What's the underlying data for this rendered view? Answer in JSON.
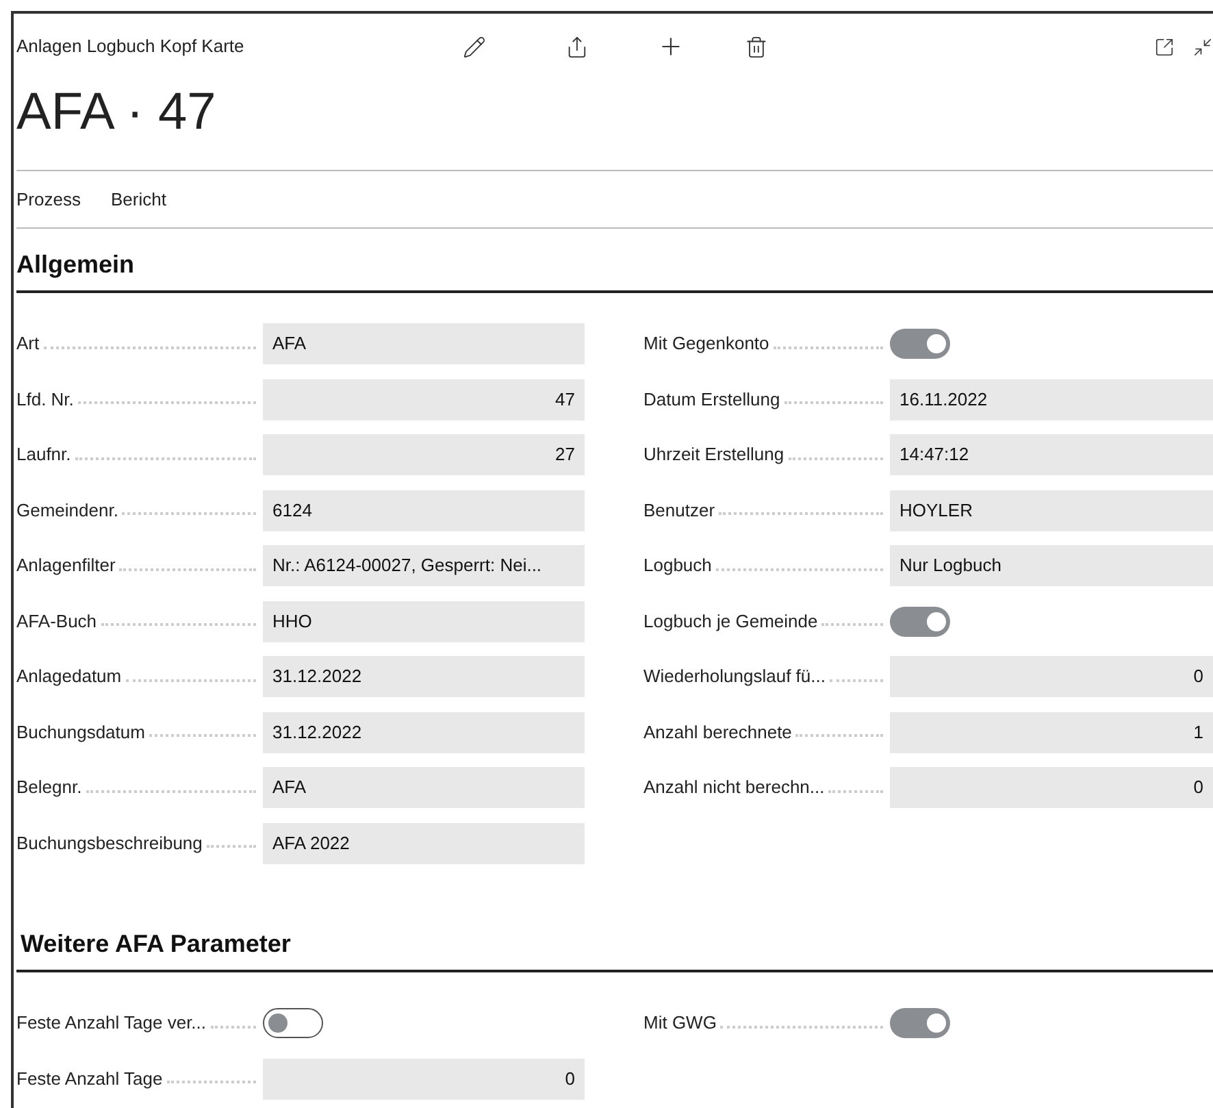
{
  "page": {
    "caption": "Anlagen Logbuch Kopf Karte",
    "title": "AFA · 47"
  },
  "actions": [
    "Prozess",
    "Bericht"
  ],
  "sections": [
    {
      "title": "Allgemein",
      "left": [
        {
          "kind": "text",
          "label": "Art",
          "value": "AFA",
          "numeric": false
        },
        {
          "kind": "text",
          "label": "Lfd. Nr.",
          "value": "47",
          "numeric": true
        },
        {
          "kind": "text",
          "label": "Laufnr.",
          "value": "27",
          "numeric": true
        },
        {
          "kind": "text",
          "label": "Gemeindenr.",
          "value": "6124",
          "numeric": false
        },
        {
          "kind": "text",
          "label": "Anlagenfilter",
          "value": "Nr.: A6124-00027, Gesperrt: Nei...",
          "numeric": false
        },
        {
          "kind": "text",
          "label": "AFA-Buch",
          "value": "HHO",
          "numeric": false
        },
        {
          "kind": "text",
          "label": "Anlagedatum",
          "value": "31.12.2022",
          "numeric": false
        },
        {
          "kind": "text",
          "label": "Buchungsdatum",
          "value": "31.12.2022",
          "numeric": false
        },
        {
          "kind": "text",
          "label": "Belegnr.",
          "value": "AFA",
          "numeric": false
        },
        {
          "kind": "text",
          "label": "Buchungsbeschreibung",
          "value": "AFA 2022",
          "numeric": false
        }
      ],
      "right": [
        {
          "kind": "toggle",
          "label": "Mit Gegenkonto",
          "on": true
        },
        {
          "kind": "text",
          "label": "Datum Erstellung",
          "value": "16.11.2022",
          "numeric": false
        },
        {
          "kind": "text",
          "label": "Uhrzeit Erstellung",
          "value": "14:47:12",
          "numeric": false
        },
        {
          "kind": "text",
          "label": "Benutzer",
          "value": "HOYLER",
          "numeric": false
        },
        {
          "kind": "text",
          "label": "Logbuch",
          "value": "Nur Logbuch",
          "numeric": false
        },
        {
          "kind": "toggle",
          "label": "Logbuch je Gemeinde",
          "on": true
        },
        {
          "kind": "text",
          "label": "Wiederholungslauf fü...",
          "value": "0",
          "numeric": true
        },
        {
          "kind": "text",
          "label": "Anzahl berechnete",
          "value": "1",
          "numeric": true
        },
        {
          "kind": "text",
          "label": "Anzahl nicht berechn...",
          "value": "0",
          "numeric": true
        }
      ]
    },
    {
      "title": "Weitere AFA Parameter",
      "left": [
        {
          "kind": "toggle",
          "label": "Feste Anzahl Tage ver...",
          "on": false
        },
        {
          "kind": "text",
          "label": "Feste Anzahl Tage",
          "value": "0",
          "numeric": true
        }
      ],
      "right": [
        {
          "kind": "toggle",
          "label": "Mit GWG",
          "on": true
        }
      ]
    }
  ]
}
